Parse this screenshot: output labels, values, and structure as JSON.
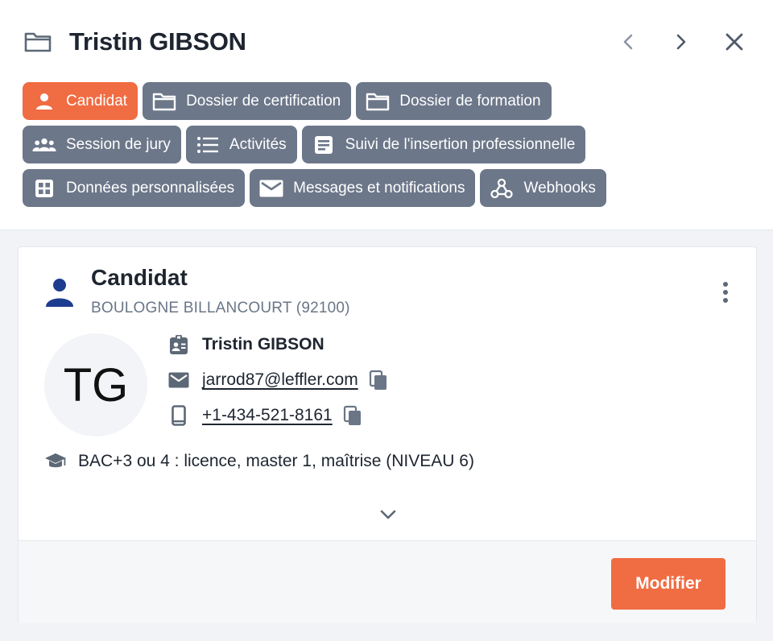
{
  "header": {
    "title": "Tristin GIBSON",
    "icons": {
      "folder": "folder-icon",
      "prev": "chevron-left-icon",
      "next": "chevron-right-icon",
      "close": "close-icon"
    }
  },
  "tabs": {
    "row1": [
      {
        "label": "Candidat",
        "icon": "person-icon",
        "active": true
      },
      {
        "label": "Dossier de certification",
        "icon": "folder-icon",
        "active": false
      },
      {
        "label": "Dossier de formation",
        "icon": "folder-icon",
        "active": false
      }
    ],
    "row2": [
      {
        "label": "Session de jury",
        "icon": "group-icon",
        "active": false
      },
      {
        "label": "Activités",
        "icon": "list-icon",
        "active": false
      },
      {
        "label": "Suivi de l'insertion professionnelle",
        "icon": "article-icon",
        "active": false
      }
    ],
    "row3": [
      {
        "label": "Données personnalisées",
        "icon": "grid-icon",
        "active": false
      },
      {
        "label": "Messages et notifications",
        "icon": "mail-icon",
        "active": false
      },
      {
        "label": "Webhooks",
        "icon": "webhook-icon",
        "active": false
      }
    ]
  },
  "card": {
    "title": "Candidat",
    "location": "BOULOGNE BILLANCOURT (92100)",
    "avatar_initials": "TG",
    "name": "Tristin GIBSON",
    "email": "jarrod87@leffler.com",
    "phone": "+1-434-521-8161",
    "education": "BAC+3 ou 4 : licence, master 1, maîtrise (NIVEAU 6)",
    "modify_label": "Modifier"
  },
  "colors": {
    "accent": "#f06c42",
    "tab_bg": "#6c7789",
    "title_icon_blue": "#1f3d8f",
    "text_dark": "#1e2530",
    "text_muted": "#6a7686"
  }
}
